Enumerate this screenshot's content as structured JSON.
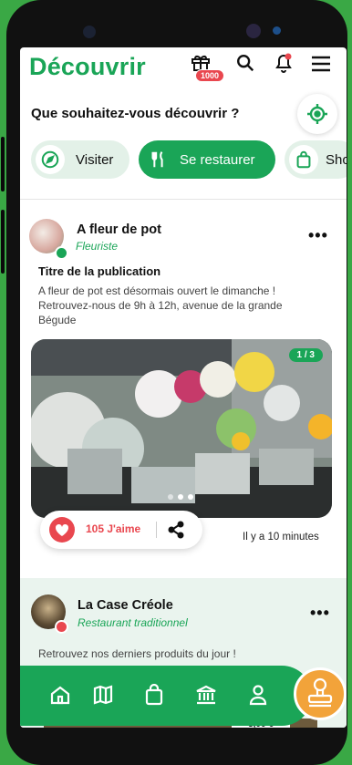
{
  "app": {
    "title": "Découvrir"
  },
  "header": {
    "gift_badge": "1000"
  },
  "discover": {
    "question": "Que souhaitez-vous découvrir ?",
    "chips": [
      {
        "label": "Visiter",
        "icon": "compass-icon",
        "active": false
      },
      {
        "label": "Se restaurer",
        "icon": "fork-knife-icon",
        "active": true
      },
      {
        "label": "Sho",
        "icon": "shopping-bag-icon",
        "active": false
      }
    ]
  },
  "posts": [
    {
      "author": "A fleur de pot",
      "category": "Fleuriste",
      "title": "Titre de la publication",
      "text": "A fleur de pot est désormais ouvert le dimanche ! Retrouvez-nous de 9h à 12h, avenue de la grande Bégude",
      "image_counter": "1 / 3",
      "likes": "105 J'aime",
      "time": "Il y a 10 minutes"
    },
    {
      "author": "La Case Créole",
      "category": "Restaurant traditionnel",
      "text": "Retrouvez nos derniers produits du jour !",
      "price": "3,00 €"
    }
  ],
  "nav": {
    "items": [
      "home-icon",
      "map-icon",
      "shopping-bag-icon",
      "museum-icon",
      "user-icon"
    ],
    "fab_icon": "stamp-icon"
  },
  "colors": {
    "brand": "#1aa557",
    "accent": "#f2a33a",
    "like": "#e9474f"
  }
}
